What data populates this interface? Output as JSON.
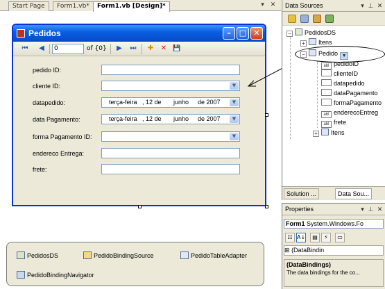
{
  "designer": {
    "tabs": [
      {
        "label": "Start Page"
      },
      {
        "label": "Form1.vb*"
      },
      {
        "label": "Form1.vb [Design]*"
      }
    ],
    "controls": {
      "dropdown": "▾",
      "close": "✕"
    }
  },
  "form": {
    "title": "Pedidos",
    "title_buttons": {
      "minimize": "–",
      "maximize": "□",
      "close": "✕"
    },
    "navigator": {
      "move_first": "⏮",
      "move_previous": "◀",
      "position": "0",
      "count_label": "of {0}",
      "move_next": "▶",
      "move_last": "⏭",
      "add_new": "✚",
      "delete": "✕",
      "save": "💾"
    },
    "fields": [
      {
        "label": "pedido ID:",
        "type": "text",
        "value": ""
      },
      {
        "label": "cliente ID:",
        "type": "combo",
        "value": ""
      },
      {
        "label": "datapedido:",
        "type": "date",
        "weekday": "terça-feira",
        "day": ", 12 de",
        "month": "junho",
        "year": "de 2007"
      },
      {
        "label": "data Pagamento:",
        "type": "date",
        "weekday": "terça-feira",
        "day": ", 12 de",
        "month": "junho",
        "year": "de 2007"
      },
      {
        "label": "forma Pagamento ID:",
        "type": "combo",
        "value": ""
      },
      {
        "label": "endereco Entrega:",
        "type": "text",
        "value": ""
      },
      {
        "label": "frete:",
        "type": "text",
        "value": ""
      }
    ]
  },
  "tray": {
    "items": [
      {
        "label": "PedidosDS"
      },
      {
        "label": "PedidoBindingSource"
      },
      {
        "label": "PedidoTableAdapter"
      },
      {
        "label": "PedidoBindingNavigator"
      }
    ]
  },
  "data_sources": {
    "title": "Data Sources",
    "controls": {
      "dropdown": "▾",
      "pin": "⊥",
      "close": "✕"
    },
    "tree": {
      "root": "PedidosDS",
      "itens_top": "Itens",
      "pedido": "Pedido",
      "pedido_fields": [
        "pedidoID",
        "clienteID",
        "datapedido",
        "dataPagamento",
        "formaPagamento",
        "enderecoEntreg",
        "frete"
      ],
      "itens_child": "Itens",
      "expander_plus": "+",
      "expander_minus": "−",
      "field_icon_text": "abl"
    },
    "bottom_tabs": [
      {
        "label": "Solution ..."
      },
      {
        "label": "Data Sou..."
      }
    ]
  },
  "properties": {
    "title": "Properties",
    "controls": {
      "dropdown": "▾",
      "pin": "⊥",
      "close": "✕"
    },
    "object": "Form1",
    "object_type": "System.Windows.Fo",
    "grid_row": {
      "expander": "⊞",
      "name": "(DataBindin"
    },
    "description_title": "(DataBindings)",
    "description_text": "The data bindings for the co..."
  }
}
